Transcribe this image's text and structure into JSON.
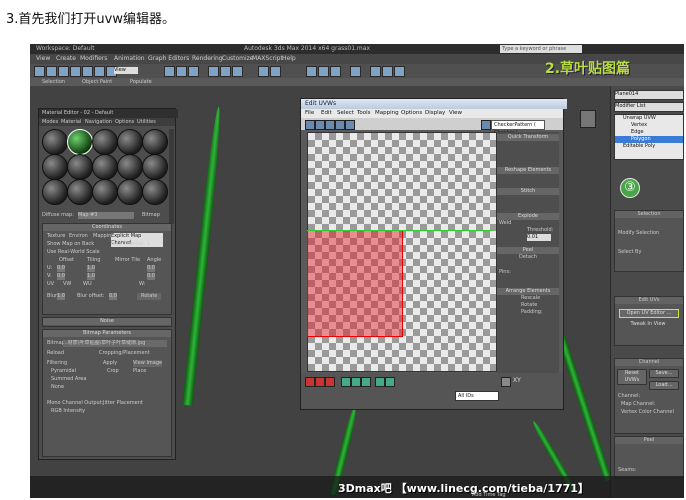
{
  "caption": "3.首先我们打开uvw编辑器。",
  "banner": "2.草叶贴图篇",
  "step_badge": "③",
  "footer": "3Dmax吧 【www.linecg.com/tieba/1771】",
  "max": {
    "title": "Autodesk 3ds Max 2014 x64  grass01.max",
    "workspace": "Workspace: Default",
    "search_placeholder": "Type a keyword or phrase",
    "menus": [
      "View",
      "Create",
      "Modifiers",
      "Animation",
      "Graph Editors",
      "Rendering",
      "Customize",
      "MAXScript",
      "Help"
    ],
    "view_dropdown": "View",
    "ribbon_tabs": [
      "Selection",
      "Object Paint",
      "Populate"
    ],
    "time_hint": "Add Time Tag",
    "colors": {
      "accent": "#b7df39",
      "badge": "#4aa44a",
      "uv_selection": "#e61e28"
    }
  },
  "command_panel": {
    "object_name": "Plane014",
    "modifier_list": "Modifier List",
    "stack": [
      "Unwrap UVW",
      "Vertex",
      "Edge",
      "Polygon",
      "Editable Poly"
    ],
    "selection_header": "Selection",
    "modify_selection": "Modify Selection",
    "select_by": "Select By",
    "edit_uvs_header": "Edit UVs",
    "open_uv_editor": "Open UV Editor ...",
    "tweak_in_view": "Tweak In View",
    "channel_header": "Channel",
    "reset_uvws": "Reset UVWs",
    "save": "Save...",
    "load": "Load...",
    "channel_label": "Channel:",
    "map_channel": "Map Channel:",
    "vertex_color_channel": "Vertex Color Channel",
    "peel_header": "Peel",
    "seams": "Seams:"
  },
  "material_editor": {
    "title": "Material Editor - 02 - Default",
    "menus": [
      "Modes",
      "Material",
      "Navigation",
      "Options",
      "Utilities"
    ],
    "diffuse_label": "Diffuse map:",
    "map_name": "Map #3",
    "map_type": "Bitmap",
    "coordinates_header": "Coordinates",
    "texture": "Texture",
    "environ": "Environ",
    "mapping_label": "Mapping:",
    "mapping_value": "Explicit Map Channel",
    "map_channel_label": "Map Channel:",
    "map_channel_value": "1",
    "show_map_back": "Show Map on Back",
    "real_world": "Use Real-World Scale",
    "offset": "Offset",
    "tiling": "Tiling",
    "mirror_tile": "Mirror Tile",
    "angle": "Angle",
    "u": "U:",
    "v": "V:",
    "w": "W:",
    "uvw_opts": [
      "UV",
      "VW",
      "WU"
    ],
    "values": [
      "0.0",
      "1.0",
      "0.0"
    ],
    "blur": "Blur:",
    "blur_val": "1.0",
    "blur_offset": "Blur offset:",
    "blur_offset_val": "0.0",
    "rotate": "Rotate",
    "noise_header": "Noise",
    "bitmap_params_header": "Bitmap Parameters",
    "bitmap_label": "Bitmap:",
    "bitmap_path": "...材质\\叶草贴图\\草叶子叶草缝隙.jpg",
    "reload": "Reload",
    "cropping": "Cropping/Placement",
    "apply": "Apply",
    "view_image": "View Image",
    "crop": "Crop",
    "place": "Place",
    "filtering": "Filtering",
    "pyramidal": "Pyramidal",
    "summed_area": "Summed Area",
    "none": "None",
    "mono_output": "Mono Channel Output:",
    "rgb_intensity": "RGB Intensity",
    "jitter": "Jitter Placement"
  },
  "uvw_editor": {
    "title": "Edit UVWs",
    "menus": [
      "File",
      "Edit",
      "Select",
      "Tools",
      "Mapping",
      "Options",
      "Display",
      "View"
    ],
    "checker_dropdown": "CheckerPattern ( Checker )",
    "quick_transform": "Quick Transform",
    "reshape": "Reshape Elements",
    "stitch": "Stitch",
    "explode": "Explode",
    "weld": "Weld",
    "threshold": "Threshold:",
    "threshold_val": "0.01",
    "peel": "Peel",
    "detach": "Detach",
    "pins": "Pins:",
    "arrange": "Arrange Elements",
    "rescale": "Rescale",
    "rotate": "Rotate",
    "padding": "Padding:",
    "all_ids": "All IDs",
    "xy": "XY"
  }
}
